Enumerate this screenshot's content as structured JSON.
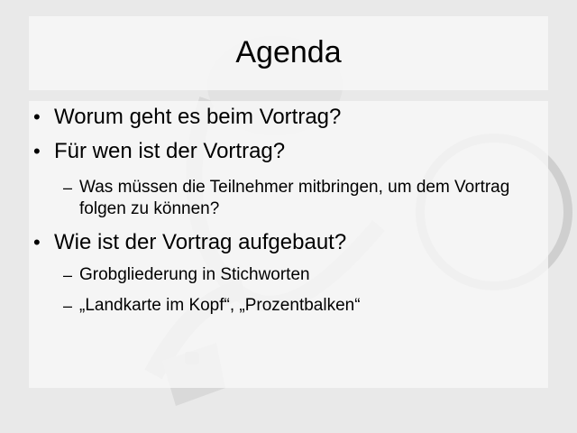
{
  "slide": {
    "title": "Agenda",
    "items": [
      {
        "level": 1,
        "marker": "•",
        "text": "Worum geht es beim Vortrag?"
      },
      {
        "level": 1,
        "marker": "•",
        "text": "Für wen ist der Vortrag?"
      },
      {
        "level": 2,
        "marker": "–",
        "text": "Was müssen die Teilnehmer mitbringen, um dem Vortrag folgen zu können?"
      },
      {
        "level": 1,
        "marker": "•",
        "text": "Wie ist der Vortrag aufgebaut?"
      },
      {
        "level": 2,
        "marker": "–",
        "text": "Grobgliederung in Stichworten"
      },
      {
        "level": 2,
        "marker": "–",
        "text": "„Landkarte im Kopf“, „Prozentbalken“"
      }
    ]
  },
  "background": {
    "image": "faded-stopwatch-icon",
    "color": "#e9e9e9"
  }
}
